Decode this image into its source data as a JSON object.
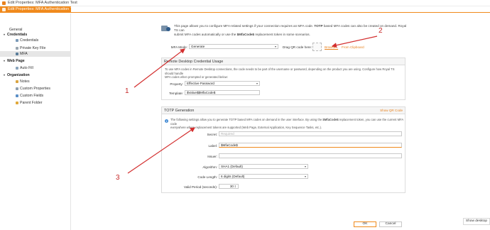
{
  "window": {
    "title": "Edit Properties: MFA Authentication Test"
  },
  "tab": {
    "label": "Edit Properties: MFA Authentication Test"
  },
  "sidebar": {
    "general": "General",
    "credentials_section": "Credentials",
    "credentials": "Credentials",
    "private_key": "Private Key File",
    "mfa": "MFA",
    "web_page_section": "Web Page",
    "auto_fill": "Auto Fill",
    "organization_section": "Organization",
    "notes": "Notes",
    "custom_properties": "Custom Properties",
    "custom_fields": "Custom Fields",
    "parent_folder": "Parent Folder"
  },
  "intro": {
    "line1_a": "This page allows you to configure MFA-related settings if your connection requires an MFA code. ",
    "line1_b": "TOTP",
    "line1_c": " based MFA codes can also be created on demand. Royal TS can",
    "line2_a": "submit MFA codes automatically or use the ",
    "line2_b": "$MfaCode$",
    "line2_c": " replacement token in some scenarios."
  },
  "mfa_mode": {
    "label": "MFA Mode:",
    "value": "Generate"
  },
  "qr": {
    "label": "Drag QR code here:",
    "browse": "Browse...",
    "from_clipboard": "From Clipboard"
  },
  "rdp_panel": {
    "title": "Remote Desktop Credential Usage",
    "desc1": "To use MFA codes in Remote Desktop connections, the code needs to be part of the username or password, depending on the product you are using. Configure how Royal TS should handle",
    "desc2": "MFA codes when prompted or generated below:",
    "property_label": "Property:",
    "property_value": "Effective Password",
    "template_label": "Template:",
    "template_value": "$Value$$MfaCode$"
  },
  "totp_panel": {
    "title": "TOTP Generation",
    "show_qr": "Show QR Code",
    "desc1_a": "The following settings allow you to generate TOTP based MFA codes on demand in the user interface. By using the ",
    "desc1_b": "$MfaCode$",
    "desc1_c": " replacement token, you can use the current MFA code",
    "desc2": "everywhere where replacement tokens are supported (Web Page, External Application, Key Sequence Tasks, etc.).",
    "secret_label": "Secret:",
    "secret_placeholder": "Required",
    "label_label": "Label:",
    "label_value": "$MfaCode$",
    "issuer_label": "Issuer:",
    "issuer_value": "",
    "algorithm_label": "Algorithm:",
    "algorithm_value": "SHA1 (Default)",
    "code_length_label": "Code Length:",
    "code_length_value": "6 digits (Default)",
    "valid_period_label": "Valid Period (seconds):",
    "valid_period_value": "30"
  },
  "annotations": {
    "one": "1",
    "two": "2",
    "three": "3"
  },
  "footer": {
    "ok": "OK",
    "cancel": "Cancel"
  },
  "taskbar": {
    "show_desktop": "Show desktop"
  }
}
